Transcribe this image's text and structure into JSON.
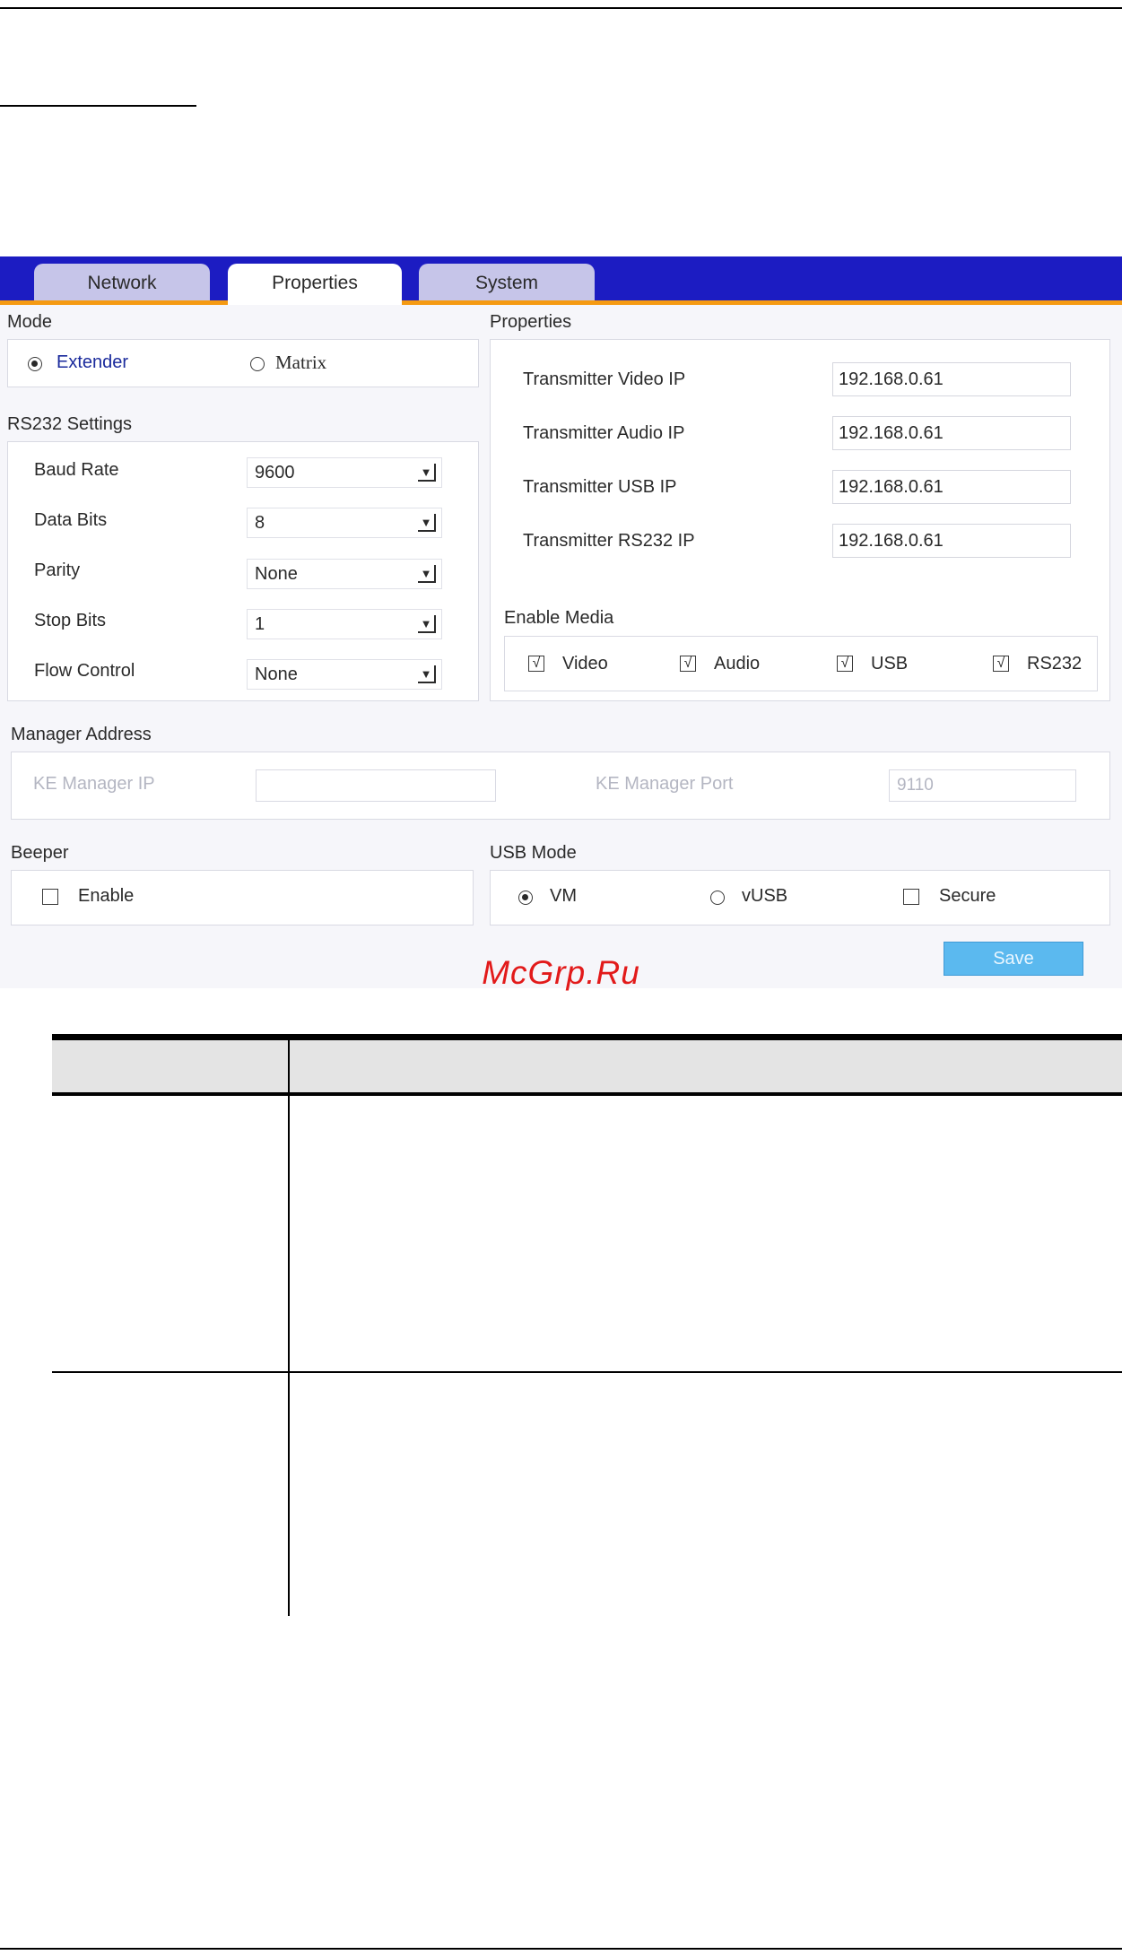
{
  "tabs": [
    {
      "label": "Network",
      "active": false
    },
    {
      "label": "Properties",
      "active": true
    },
    {
      "label": "System",
      "active": false
    }
  ],
  "mode": {
    "title": "Mode",
    "options": [
      {
        "label": "Extender",
        "selected": true
      },
      {
        "label": "Matrix",
        "selected": false
      }
    ]
  },
  "rs232": {
    "title": "RS232 Settings",
    "fields": [
      {
        "label": "Baud Rate",
        "value": "9600"
      },
      {
        "label": "Data Bits",
        "value": "8"
      },
      {
        "label": "Parity",
        "value": "None"
      },
      {
        "label": "Stop Bits",
        "value": "1"
      },
      {
        "label": "Flow Control",
        "value": "None"
      }
    ]
  },
  "properties": {
    "title": "Properties",
    "fields": [
      {
        "label": "Transmitter Video IP",
        "value": "192.168.0.61"
      },
      {
        "label": "Transmitter Audio IP",
        "value": "192.168.0.61"
      },
      {
        "label": "Transmitter USB IP",
        "value": "192.168.0.61"
      },
      {
        "label": "Transmitter RS232 IP",
        "value": "192.168.0.61"
      }
    ],
    "enable_media_title": "Enable Media",
    "media": [
      {
        "label": "Video",
        "checked": true
      },
      {
        "label": "Audio",
        "checked": true
      },
      {
        "label": "USB",
        "checked": true
      },
      {
        "label": "RS232",
        "checked": true
      }
    ]
  },
  "manager": {
    "title": "Manager Address",
    "ip_label": "KE Manager IP",
    "ip_value": "",
    "port_label": "KE Manager Port",
    "port_value": "9110"
  },
  "beeper": {
    "title": "Beeper",
    "enable_label": "Enable",
    "enabled": false
  },
  "usb_mode": {
    "title": "USB Mode",
    "options": [
      {
        "label": "VM",
        "selected": true
      },
      {
        "label": "vUSB",
        "selected": false
      }
    ],
    "secure_label": "Secure",
    "secure": false
  },
  "save_label": "Save",
  "watermark": "McGrp.Ru",
  "icons": {
    "checkmark": "√",
    "dropdown_arrow": "▼"
  }
}
